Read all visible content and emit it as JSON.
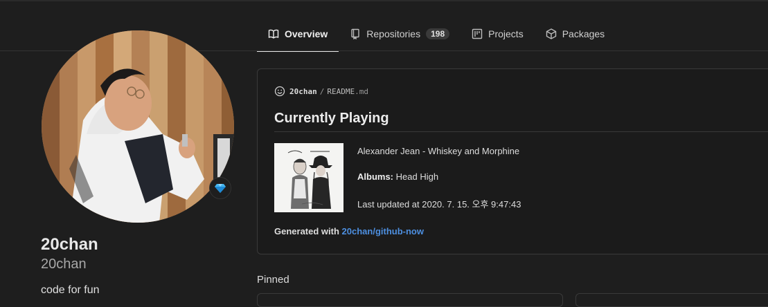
{
  "nav": {
    "tabs": [
      {
        "label": "Overview",
        "icon": "book-icon",
        "selected": true
      },
      {
        "label": "Repositories",
        "icon": "repo-icon",
        "count": "198"
      },
      {
        "label": "Projects",
        "icon": "project-icon"
      },
      {
        "label": "Packages",
        "icon": "package-icon"
      }
    ]
  },
  "profile": {
    "name": "20chan",
    "login": "20chan",
    "bio": "code for fun",
    "status_icon": "gem-icon"
  },
  "readme": {
    "owner": "20chan",
    "separator": "/",
    "filename": "README",
    "extension": ".md",
    "heading": "Currently Playing",
    "track": "Alexander Jean - Whiskey and Morphine",
    "albums_label": "Albums:",
    "album": "Head High",
    "last_updated": "Last updated at 2020. 7. 15. 오후 9:47:43",
    "generated_prefix": "Generated with",
    "generated_link": "20chan/github-now"
  },
  "pinned": {
    "heading": "Pinned"
  },
  "colors": {
    "background": "#1e1e1e",
    "link": "#4d8fe0",
    "border": "#3a3a3a"
  }
}
